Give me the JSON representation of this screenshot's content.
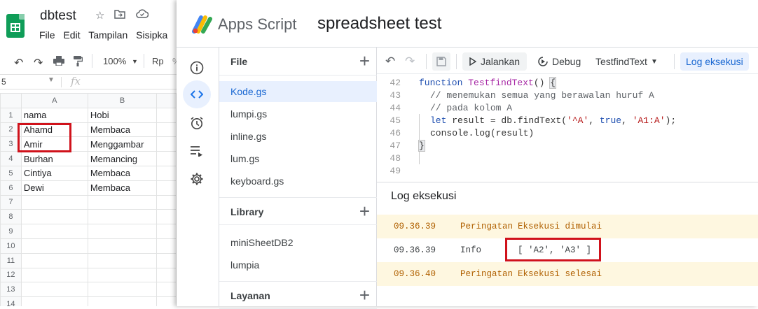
{
  "sheets": {
    "title": "dbtest",
    "menu": [
      "File",
      "Edit",
      "Tampilan",
      "Sisipka"
    ],
    "toolbar": {
      "zoom": "100%",
      "currency": "Rp"
    },
    "name_box": "5",
    "fx": "fx",
    "columns": [
      "A",
      "B"
    ],
    "rows": [
      {
        "n": "1",
        "a": "nama",
        "b": "Hobi"
      },
      {
        "n": "2",
        "a": "Ahamd",
        "b": "Membaca"
      },
      {
        "n": "3",
        "a": "Amir",
        "b": "Menggambar"
      },
      {
        "n": "4",
        "a": "Burhan",
        "b": "Memancing"
      },
      {
        "n": "5",
        "a": "Cintiya",
        "b": "Membaca"
      },
      {
        "n": "6",
        "a": "Dewi",
        "b": "Membaca"
      },
      {
        "n": "7",
        "a": "",
        "b": ""
      },
      {
        "n": "8",
        "a": "",
        "b": ""
      },
      {
        "n": "9",
        "a": "",
        "b": ""
      },
      {
        "n": "10",
        "a": "",
        "b": ""
      },
      {
        "n": "11",
        "a": "",
        "b": ""
      },
      {
        "n": "12",
        "a": "",
        "b": ""
      },
      {
        "n": "13",
        "a": "",
        "b": ""
      },
      {
        "n": "14",
        "a": "",
        "b": ""
      }
    ]
  },
  "appsscript": {
    "app_name": "Apps Script",
    "project": "spreadsheet test",
    "sections": {
      "file": "File",
      "library": "Library",
      "services": "Layanan"
    },
    "files": [
      "Kode.gs",
      "lumpi.gs",
      "inline.gs",
      "lum.gs",
      "keyboard.gs"
    ],
    "libraries": [
      "miniSheetDB2",
      "lumpia"
    ],
    "toolbar": {
      "run": "Jalankan",
      "debug": "Debug",
      "function": "TestfindText",
      "log": "Log eksekusi"
    },
    "code_lines": [
      {
        "n": "42"
      },
      {
        "n": "43"
      },
      {
        "n": "44"
      },
      {
        "n": "45"
      },
      {
        "n": "46"
      },
      {
        "n": "47"
      },
      {
        "n": "48"
      },
      {
        "n": "49"
      }
    ],
    "code": {
      "l42_kw": "function ",
      "l42_fn": "TestfindText",
      "l42_rest": "() ",
      "brace_open": "{",
      "brace_close": "}",
      "l43": "// menemukan semua yang berawalan huruf A",
      "l44": "// pada kolom A",
      "l45_kw": "let",
      "l45_a": " result = db.findText(",
      "l45_s1": "'^A'",
      "l45_b": ", ",
      "l45_t": "true",
      "l45_c": ", ",
      "l45_s2": "'A1:A'",
      "l45_d": ");",
      "l46": "console.log(result)"
    },
    "log_title": "Log eksekusi",
    "log": [
      {
        "time": "09.36.39",
        "level": "Peringatan",
        "msg": "Eksekusi dimulai"
      },
      {
        "time": "09.36.39",
        "level": "Info",
        "msg": "[ 'A2', 'A3' ]"
      },
      {
        "time": "09.36.40",
        "level": "Peringatan",
        "msg": "Eksekusi selesai"
      }
    ]
  }
}
